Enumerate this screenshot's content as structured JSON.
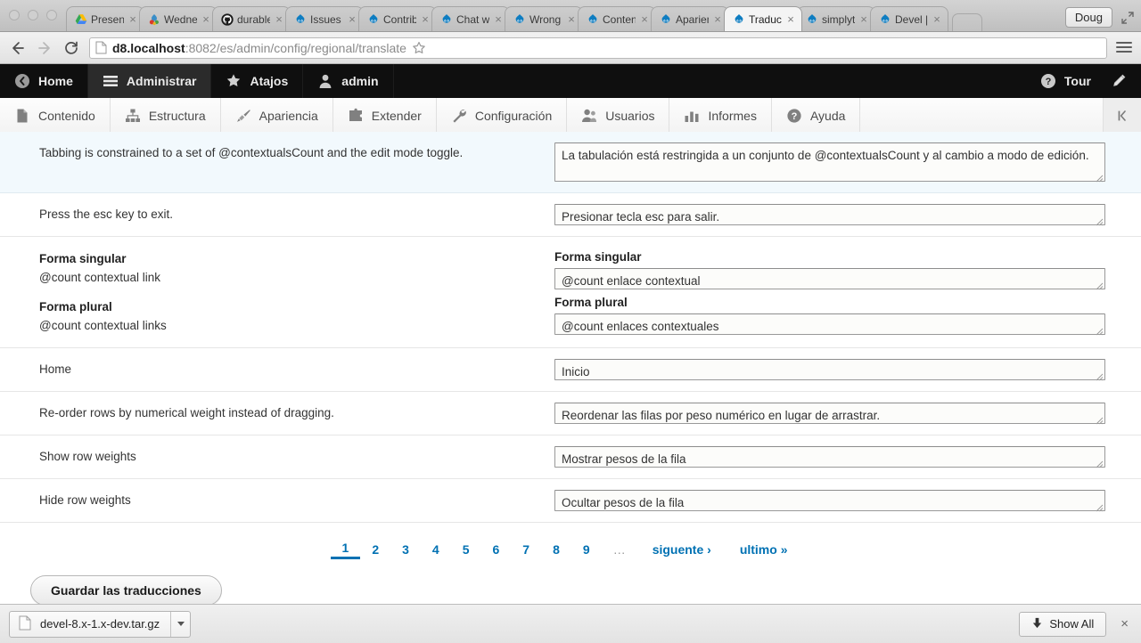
{
  "browser": {
    "window_buttons": [
      "close",
      "minimize",
      "zoom"
    ],
    "tabs": [
      {
        "label": "Present",
        "icon": "google-drive-icon",
        "active": false
      },
      {
        "label": "Wednes",
        "icon": "colorful-icon",
        "active": false
      },
      {
        "label": "durable",
        "icon": "github-icon",
        "active": false
      },
      {
        "label": "Issues",
        "icon": "drupal-icon",
        "active": false
      },
      {
        "label": "Contrib",
        "icon": "drupal-icon",
        "active": false
      },
      {
        "label": "Chat w",
        "icon": "drupal-icon",
        "active": false
      },
      {
        "label": "Wrong",
        "icon": "drupal-icon",
        "active": false
      },
      {
        "label": "Conten",
        "icon": "drupal-icon",
        "active": false
      },
      {
        "label": "Aparien",
        "icon": "drupal-icon",
        "active": false
      },
      {
        "label": "Traduc",
        "icon": "drupal-icon",
        "active": true
      },
      {
        "label": "simplyt",
        "icon": "drupal-icon",
        "active": false
      },
      {
        "label": "Devel |",
        "icon": "drupal-icon",
        "active": false
      }
    ],
    "tab_close_glyph": "×",
    "user_chip": "Doug",
    "url_bold": "d8.localhost",
    "url_rest": ":8082/es/admin/config/regional/translate",
    "url_full": "d8.localhost:8082/es/admin/config/regional/translate"
  },
  "admin_toolbar": {
    "items": [
      {
        "label": "Home",
        "icon": "back-circle-icon",
        "active": false
      },
      {
        "label": "Administrar",
        "icon": "hamburger-icon",
        "active": true
      },
      {
        "label": "Atajos",
        "icon": "star-icon",
        "active": false
      },
      {
        "label": "admin",
        "icon": "user-icon",
        "active": false
      }
    ],
    "tour_label": "Tour",
    "tour_icon": "question-circle-icon",
    "edit_icon": "pencil-icon"
  },
  "admin_menu": {
    "items": [
      {
        "label": "Contenido",
        "icon": "page-icon"
      },
      {
        "label": "Estructura",
        "icon": "sitemap-icon"
      },
      {
        "label": "Apariencia",
        "icon": "paintbrush-icon"
      },
      {
        "label": "Extender",
        "icon": "puzzle-icon"
      },
      {
        "label": "Configuración",
        "icon": "wrench-icon"
      },
      {
        "label": "Usuarios",
        "icon": "users-icon"
      },
      {
        "label": "Informes",
        "icon": "bars-chart-icon"
      },
      {
        "label": "Ayuda",
        "icon": "question-circle-icon"
      }
    ],
    "collapse_icon": "collapse-left-icon"
  },
  "translate_rows": [
    {
      "type": "simple",
      "highlight": true,
      "source": "Tabbing is constrained to a set of @contextualsCount and the edit mode toggle.",
      "translation": "La tabulación está restringida a un conjunto de @contextualsCount y al cambio a modo de edición.",
      "rows": 2
    },
    {
      "type": "simple",
      "highlight": false,
      "source": "Press the esc key to exit.",
      "translation": "Presionar tecla esc para salir.",
      "rows": 1
    },
    {
      "type": "plural",
      "highlight": false,
      "singular_label": "Forma singular",
      "plural_label": "Forma plural",
      "source_singular": "@count contextual link",
      "source_plural": "@count contextual links",
      "translation_singular": "@count enlace contextual",
      "translation_plural": "@count enlaces contextuales"
    },
    {
      "type": "simple",
      "highlight": false,
      "source": "Home",
      "translation": "Inicio",
      "rows": 1
    },
    {
      "type": "simple",
      "highlight": false,
      "source": "Re-order rows by numerical weight instead of dragging.",
      "translation": "Reordenar las filas por peso numérico en lugar de arrastrar.",
      "rows": 1
    },
    {
      "type": "simple",
      "highlight": false,
      "source": "Show row weights",
      "translation": "Mostrar pesos de la fila",
      "rows": 1
    },
    {
      "type": "simple",
      "highlight": false,
      "source": "Hide row weights",
      "translation": "Ocultar pesos de la fila",
      "rows": 1
    }
  ],
  "pager": {
    "pages": [
      "1",
      "2",
      "3",
      "4",
      "5",
      "6",
      "7",
      "8",
      "9"
    ],
    "current": "1",
    "ellipsis": "…",
    "next_label": "siguente ›",
    "last_label": "ultimo »"
  },
  "form": {
    "save_label": "Guardar las traducciones"
  },
  "download_shelf": {
    "file_name": "devel-8.x-1.x-dev.tar.gz",
    "file_icon": "file-icon",
    "menu_icon": "caret-down-icon",
    "show_all_label": "Show All",
    "show_all_icon": "download-arrow-icon",
    "close_glyph": "×"
  },
  "colors": {
    "link": "#0071b3",
    "highlight_row": "#f2f9fd",
    "toolbar_bg": "#0f0f0f",
    "toolbar_active": "#2b2b2b"
  }
}
